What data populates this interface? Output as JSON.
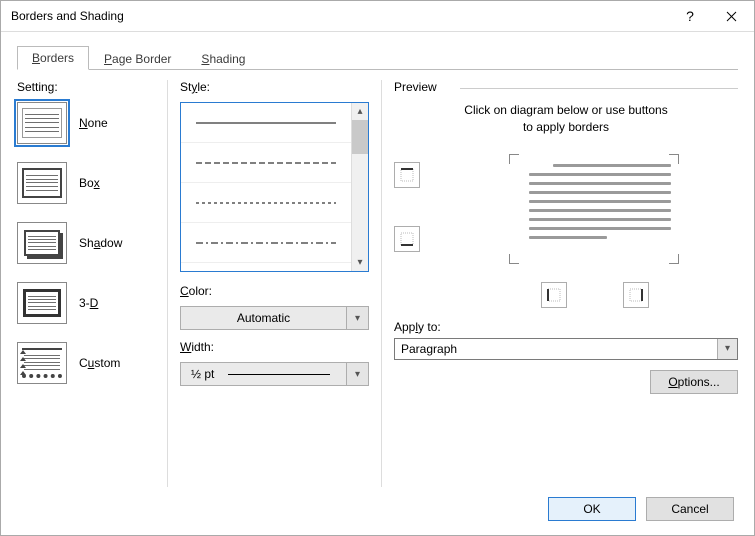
{
  "window": {
    "title": "Borders and Shading"
  },
  "tabs": {
    "borders": "Borders",
    "pageBorder": "Page Border",
    "shading": "Shading"
  },
  "setting": {
    "label": "Setting:",
    "none": "None",
    "box": "Box",
    "shadow": "Shadow",
    "threed": "3-D",
    "custom": "Custom"
  },
  "style": {
    "label": "Style:",
    "colorLabel": "Color:",
    "colorValue": "Automatic",
    "widthLabel": "Width:",
    "widthValue": "½ pt"
  },
  "preview": {
    "label": "Preview",
    "hint1": "Click on diagram below or use buttons",
    "hint2": "to apply borders",
    "applyLabel": "Apply to:",
    "applyValue": "Paragraph",
    "optionsLabel": "Options..."
  },
  "footer": {
    "ok": "OK",
    "cancel": "Cancel"
  }
}
